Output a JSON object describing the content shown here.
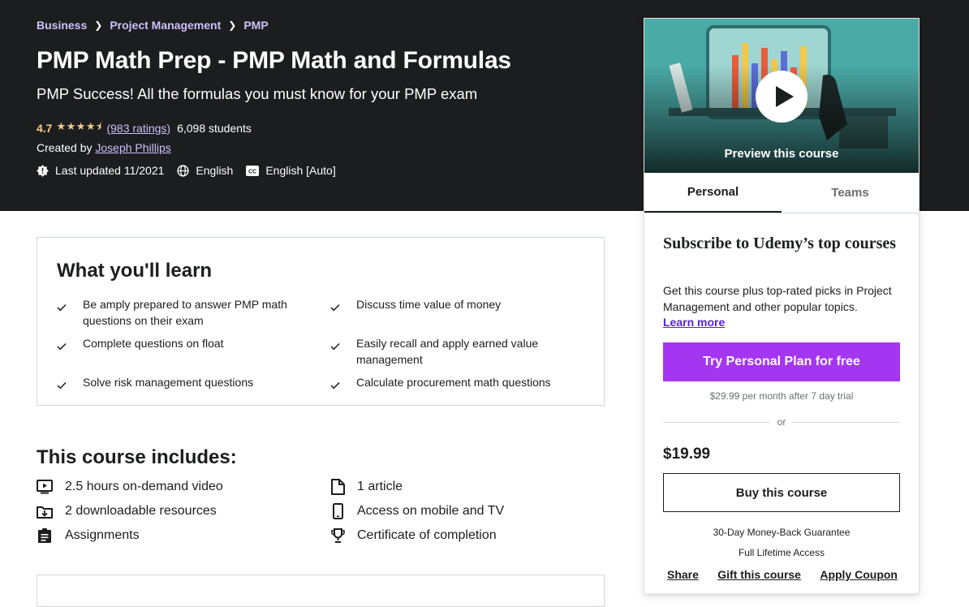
{
  "breadcrumb": [
    "Business",
    "Project Management",
    "PMP"
  ],
  "course": {
    "title": "PMP Math Prep - PMP Math and Formulas",
    "subtitle": "PMP Success! All the formulas you must know for your PMP exam",
    "rating": "4.7",
    "rating_value": 4.7,
    "ratings_link": "(983 ratings)",
    "students": "6,098 students",
    "created_by_label": "Created by",
    "instructor": "Joseph Phillips",
    "last_updated": "Last updated 11/2021",
    "language": "English",
    "captions": "English [Auto]"
  },
  "sidebar": {
    "preview_label": "Preview this course",
    "tabs": [
      {
        "label": "Personal",
        "active": true
      },
      {
        "label": "Teams",
        "active": false
      }
    ],
    "subscribe_title": "Subscribe to Udemy’s top courses",
    "subscribe_desc": "Get this course plus top-rated picks in Project Management and other popular topics.",
    "learn_more": "Learn more",
    "try_button": "Try Personal Plan for free",
    "trial_note": "$29.99 per month after 7 day trial",
    "or": "or",
    "price": "$19.99",
    "buy_button": "Buy this course",
    "guarantee": "30-Day Money-Back Guarantee",
    "lifetime": "Full Lifetime Access",
    "share": "Share",
    "gift": "Gift this course",
    "coupon": "Apply Coupon"
  },
  "learn": {
    "title": "What you'll learn",
    "items": [
      "Be amply prepared to answer PMP math questions on their exam",
      "Discuss time value of money",
      "Complete questions on float",
      "Easily recall and apply earned value management",
      "Solve risk management questions",
      "Calculate procurement math questions"
    ]
  },
  "includes": {
    "title": "This course includes:",
    "items": [
      {
        "icon": "video-icon",
        "text": "2.5 hours on-demand video"
      },
      {
        "icon": "article-icon",
        "text": "1 article"
      },
      {
        "icon": "download-icon",
        "text": "2 downloadable resources"
      },
      {
        "icon": "mobile-icon",
        "text": "Access on mobile and TV"
      },
      {
        "icon": "assignment-icon",
        "text": "Assignments"
      },
      {
        "icon": "trophy-icon",
        "text": "Certificate of completion"
      }
    ]
  },
  "colors": {
    "hero_bg": "#1c1d1f",
    "link_purple": "#cec0fc",
    "star": "#f3ca8c",
    "cta": "#a435f0",
    "learn_more": "#5624d0"
  }
}
